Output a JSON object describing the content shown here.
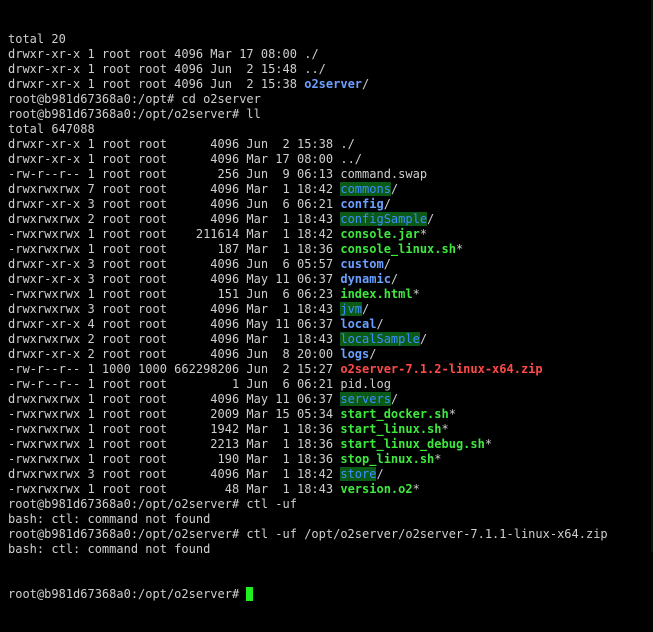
{
  "colors": {
    "background": "#000000",
    "text": "#cfcfcf",
    "directory": "#6aa0ff",
    "executable": "#3ee83e",
    "archive": "#ff4a4a",
    "highlight_fg": "#3a8fff",
    "highlight_bg": "#0b5b17",
    "cursor": "#1ff01f"
  },
  "lines": [
    [
      {
        "t": "total 20"
      }
    ],
    [
      {
        "t": "drwxr-xr-x 1 root root 4096 Mar 17 08:00 "
      },
      {
        "t": "./"
      }
    ],
    [
      {
        "t": "drwxr-xr-x 1 root root 4096 Jun  2 15:48 "
      },
      {
        "t": "../"
      }
    ],
    [
      {
        "t": "drwxr-xr-x 1 root root 4096 Jun  2 15:38 "
      },
      {
        "t": "o2server",
        "c": "dir"
      },
      {
        "t": "/"
      }
    ],
    [
      {
        "t": "root@b981d67368a0:/opt# cd o2server"
      }
    ],
    [
      {
        "t": "root@b981d67368a0:/opt/o2server# ll"
      }
    ],
    [
      {
        "t": "total 647088"
      }
    ],
    [
      {
        "t": "drwxr-xr-x 1 root root      4096 Jun  2 15:38 "
      },
      {
        "t": "./"
      }
    ],
    [
      {
        "t": "drwxr-xr-x 1 root root      4096 Mar 17 08:00 "
      },
      {
        "t": "../"
      }
    ],
    [
      {
        "t": "-rw-r--r-- 1 root root       256 Jun  9 06:13 "
      },
      {
        "t": "command.swap"
      }
    ],
    [
      {
        "t": "drwxrwxrwx 7 root root      4096 Mar  1 18:42 "
      },
      {
        "t": "commons",
        "c": "hl"
      },
      {
        "t": "/"
      }
    ],
    [
      {
        "t": "drwxr-xr-x 3 root root      4096 Jun  6 06:21 "
      },
      {
        "t": "config",
        "c": "dir"
      },
      {
        "t": "/"
      }
    ],
    [
      {
        "t": "drwxrwxrwx 2 root root      4096 Mar  1 18:43 "
      },
      {
        "t": "configSample",
        "c": "hl"
      },
      {
        "t": "/"
      }
    ],
    [
      {
        "t": "-rwxrwxrwx 1 root root    211614 Mar  1 18:42 "
      },
      {
        "t": "console.jar",
        "c": "exe"
      },
      {
        "t": "*"
      }
    ],
    [
      {
        "t": "-rwxrwxrwx 1 root root       187 Mar  1 18:36 "
      },
      {
        "t": "console_linux.sh",
        "c": "exe"
      },
      {
        "t": "*"
      }
    ],
    [
      {
        "t": "drwxr-xr-x 3 root root      4096 Jun  6 05:57 "
      },
      {
        "t": "custom",
        "c": "dir"
      },
      {
        "t": "/"
      }
    ],
    [
      {
        "t": "drwxr-xr-x 3 root root      4096 May 11 06:37 "
      },
      {
        "t": "dynamic",
        "c": "dir"
      },
      {
        "t": "/"
      }
    ],
    [
      {
        "t": "-rwxrwxrwx 1 root root       151 Jun  6 06:23 "
      },
      {
        "t": "index.html",
        "c": "exe"
      },
      {
        "t": "*"
      }
    ],
    [
      {
        "t": "drwxrwxrwx 3 root root      4096 Mar  1 18:43 "
      },
      {
        "t": "jvm",
        "c": "hl"
      },
      {
        "t": "/"
      }
    ],
    [
      {
        "t": "drwxr-xr-x 4 root root      4096 May 11 06:37 "
      },
      {
        "t": "local",
        "c": "dir"
      },
      {
        "t": "/"
      }
    ],
    [
      {
        "t": "drwxrwxrwx 2 root root      4096 Mar  1 18:43 "
      },
      {
        "t": "localSample",
        "c": "hl"
      },
      {
        "t": "/"
      }
    ],
    [
      {
        "t": "drwxr-xr-x 2 root root      4096 Jun  8 20:00 "
      },
      {
        "t": "logs",
        "c": "dir"
      },
      {
        "t": "/"
      }
    ],
    [
      {
        "t": "-rw-r--r-- 1 1000 1000 662298206 Jun  2 15:27 "
      },
      {
        "t": "o2server-7.1.2-linux-x64.zip",
        "c": "arc"
      }
    ],
    [
      {
        "t": "-rw-r--r-- 1 root root         1 Jun  6 06:21 "
      },
      {
        "t": "pid.log"
      }
    ],
    [
      {
        "t": "drwxrwxrwx 1 root root      4096 May 11 06:37 "
      },
      {
        "t": "servers",
        "c": "hl"
      },
      {
        "t": "/"
      }
    ],
    [
      {
        "t": "-rwxrwxrwx 1 root root      2009 Mar 15 05:34 "
      },
      {
        "t": "start_docker.sh",
        "c": "exe"
      },
      {
        "t": "*"
      }
    ],
    [
      {
        "t": "-rwxrwxrwx 1 root root      1942 Mar  1 18:36 "
      },
      {
        "t": "start_linux.sh",
        "c": "exe"
      },
      {
        "t": "*"
      }
    ],
    [
      {
        "t": "-rwxrwxrwx 1 root root      2213 Mar  1 18:36 "
      },
      {
        "t": "start_linux_debug.sh",
        "c": "exe"
      },
      {
        "t": "*"
      }
    ],
    [
      {
        "t": "-rwxrwxrwx 1 root root       190 Mar  1 18:36 "
      },
      {
        "t": "stop_linux.sh",
        "c": "exe"
      },
      {
        "t": "*"
      }
    ],
    [
      {
        "t": "drwxrwxrwx 3 root root      4096 Mar  1 18:42 "
      },
      {
        "t": "store",
        "c": "hl"
      },
      {
        "t": "/"
      }
    ],
    [
      {
        "t": "-rwxrwxrwx 1 root root        48 Mar  1 18:43 "
      },
      {
        "t": "version.o2",
        "c": "exe"
      },
      {
        "t": "*"
      }
    ],
    [
      {
        "t": "root@b981d67368a0:/opt/o2server# ctl -uf"
      }
    ],
    [
      {
        "t": "bash: ctl: command not found"
      }
    ],
    [
      {
        "t": "root@b981d67368a0:/opt/o2server# ctl -uf /opt/o2server/o2server-7.1.1-linux-x64.zip"
      }
    ],
    [
      {
        "t": "bash: ctl: command not found"
      }
    ]
  ],
  "prompt": "root@b981d67368a0:/opt/o2server# "
}
